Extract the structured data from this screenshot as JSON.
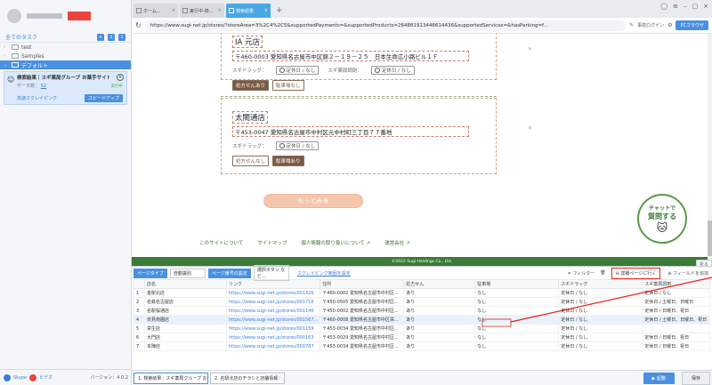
{
  "sidebar": {
    "all_tasks": "全てのタスク",
    "folders": [
      {
        "name": "test"
      },
      {
        "name": "Samples"
      },
      {
        "name": "デフォルト"
      }
    ],
    "task": {
      "title": "検索結果｜スギ薬局グループ お薬手サイト",
      "data_label": "データ数：",
      "data_count": "52",
      "status": "実行中",
      "mode": "高速スクレイピング",
      "speed_button": "スピードアップ"
    },
    "footer": {
      "skype": "Skype",
      "video": "ビデオ",
      "version": "バージョン：4.0.2"
    }
  },
  "browser": {
    "tabs": [
      {
        "label": "ホーム..."
      },
      {
        "label": "実行中-検..."
      },
      {
        "label": "検索結果"
      }
    ],
    "url": "https://www.sugi-net.jp/stores/?storeArea=3%2C4%2C5&supportedPayments=&supportedProducts=264881913446614436&supportedServices=&hasParking=f...",
    "login": "事前ログイン",
    "pc_browser": "PCブラウザ"
  },
  "page": {
    "stores": [
      {
        "name": "IA 元店",
        "address": "〒460-0003 愛知県名古屋市中区錦２－１９－２５　日本生命広小路ビル１Ｆ",
        "drug_label": "スギドラッグ：",
        "drug_hours": "定休日 / なし",
        "pharmacy_label": "スギ薬局調剤：",
        "pharmacy_hours": "定休日 / なし",
        "badge_rx": "処方せんあり",
        "badge_parking": "駐車場なし"
      },
      {
        "name": "太閤通店",
        "address": "〒453-0047 愛知県名古屋市中村区元中村町三丁目７７番地",
        "drug_label": "スギドラッグ：",
        "drug_hours": "定休日 / なし",
        "badge_rx": "処方せんなし",
        "badge_parking": "駐車場あり"
      }
    ],
    "more_button": "もっとみる",
    "footer_links": [
      "このサイトについて",
      "サイトマップ",
      "個人情報の取り扱いについて",
      "運営会社"
    ],
    "copyright": "©2022 Sugi Holdings Co., Ltd.",
    "chat_line1": "チャットで",
    "chat_line2": "質問する",
    "collapse": "折る"
  },
  "data_panel": {
    "page_type_label": "ページタイプ",
    "page_type_value": "自動識別",
    "page_turn_label": "ページ番号の設定",
    "page_turn_value": "選択ボタン など...",
    "crawl_range": "スクレイピング範囲を設定",
    "filter": "フィルター",
    "detail_button": "詳細ページに行く",
    "add_field": "フィールドを追加",
    "columns": [
      "",
      "店名",
      "リンク",
      "住所",
      "処方せん",
      "駐車場",
      "スギドラッグ",
      "スギ薬局調剤"
    ],
    "rows": [
      [
        "1",
        "金駅北店",
        "https://www.sugi-net.jp/stores/001326",
        "〒460-0002 愛知県名古屋市中村区...",
        "あり",
        "なし",
        "定休日 / なし",
        "定休日 / なし"
      ],
      [
        "2",
        "名鉄名古屋店",
        "https://www.sugi-net.jp/stores/001716",
        "〒450-0505 愛知県名古屋市中村区...",
        "あり",
        "なし",
        "定休日 / なし",
        "定休日 / 土曜日、日曜日"
      ],
      [
        "3",
        "名駅桜通店",
        "https://www.sugi-net.jp/stores/001146",
        "〒450-0002 愛知県名古屋市中村区...",
        "あり",
        "なし",
        "定休日 / なし",
        "定休日 / 日曜日、祝日"
      ],
      [
        "4",
        "伏見南園店",
        "https://www.sugi-net.jp/stores/001567...",
        "〒460-0008 愛知県名古屋市中区栄...",
        "あり",
        "なし",
        "定休日 / なし",
        "定休日 / 土曜日、日曜日、祝日"
      ],
      [
        "5",
        "栄生店",
        "https://www.sugi-net.jp/stores/001159",
        "〒453-0034 愛知県名古屋市中村区...",
        "あり",
        "なし",
        "定休日 / なし",
        ""
      ],
      [
        "6",
        "大門店",
        "https://www.sugi-net.jp/stores/000163",
        "〒453-0029 愛知県名古屋市中村区...",
        "あり",
        "なし",
        "定休日 / なし",
        "定休日 / 日曜日、祝日"
      ],
      [
        "7",
        "本陣店",
        "https://www.sugi-net.jp/stores/000787",
        "〒453-0034 愛知県名古屋市中村区...",
        "あり",
        "なし",
        "定休日 / なし",
        "定休日 / 日曜日、祝日"
      ]
    ],
    "bottom_tabs": [
      "1. 検索結果｜スギ薬局グループ お...",
      "2. 名駅北店のチラシと店舗情報｜..."
    ],
    "run": "起動",
    "save": "保存"
  },
  "colors": {
    "accent": "#4a90e2",
    "brown": "#7a5a43",
    "green": "#3b7a37",
    "annotation": "#e2231a"
  }
}
